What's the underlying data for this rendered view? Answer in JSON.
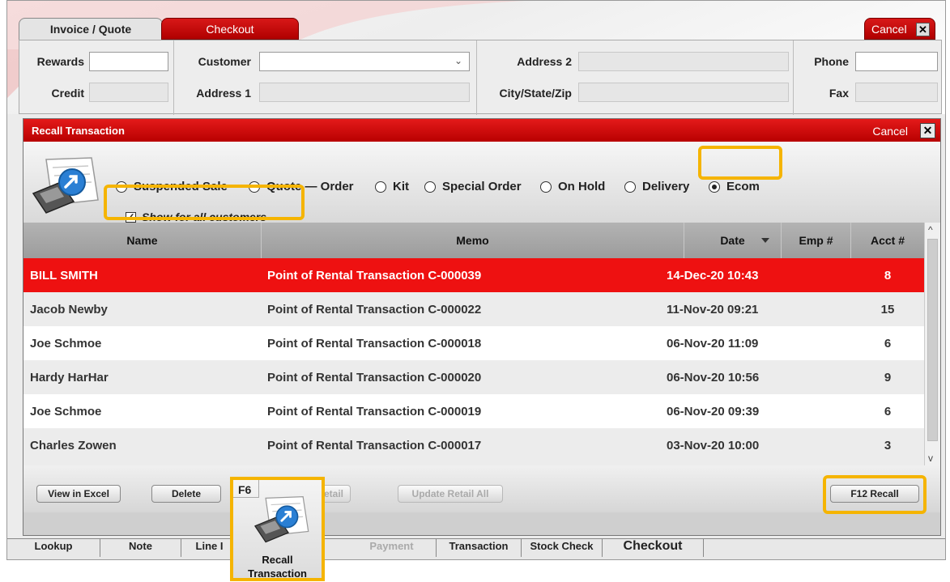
{
  "app": {
    "tabs": [
      {
        "label": "Invoice / Quote",
        "active": true
      },
      {
        "label": "Checkout",
        "active": false
      }
    ],
    "cancel_label": "Cancel",
    "close_icon": "close-icon",
    "fields": {
      "rewards_label": "Rewards",
      "credit_label": "Credit",
      "customer_label": "Customer",
      "address1_label": "Address 1",
      "address2_label": "Address 2",
      "city_label": "City/State/Zip",
      "phone_label": "Phone",
      "fax_label": "Fax",
      "rewards_value": "",
      "customer_value": "",
      "phone_value": ""
    },
    "bottom_bar": [
      "Lookup",
      "Note",
      "Line I",
      "Payment",
      "Transaction",
      "Stock Check",
      "Checkout"
    ]
  },
  "modal": {
    "title": "Recall Transaction",
    "cancel_label": "Cancel",
    "radios": [
      {
        "label": "Suspended Sale",
        "selected": false
      },
      {
        "label": "Quote — Order",
        "selected": false
      },
      {
        "label": "Kit",
        "selected": false
      },
      {
        "label": "Special Order",
        "selected": false
      },
      {
        "label": "On Hold",
        "selected": false
      },
      {
        "label": "Delivery",
        "selected": false
      },
      {
        "label": "Ecom",
        "selected": true
      }
    ],
    "show_all": {
      "label": "Show for all customers",
      "checked": true
    },
    "table": {
      "columns": [
        "Name",
        "Memo",
        "Date",
        "Emp #",
        "Acct #"
      ],
      "sort_column": "Date",
      "rows": [
        {
          "name": "BILL SMITH",
          "memo": "Point of Rental Transaction C-000039",
          "date": "14-Dec-20 10:43",
          "emp": "",
          "acct": "8",
          "selected": true
        },
        {
          "name": "Jacob Newby",
          "memo": "Point of Rental Transaction C-000022",
          "date": "11-Nov-20 09:21",
          "emp": "",
          "acct": "15"
        },
        {
          "name": "Joe Schmoe",
          "memo": "Point of Rental Transaction C-000018",
          "date": "06-Nov-20 11:09",
          "emp": "",
          "acct": "6"
        },
        {
          "name": "Hardy HarHar",
          "memo": "Point of Rental Transaction C-000020",
          "date": "06-Nov-20 10:56",
          "emp": "",
          "acct": "9"
        },
        {
          "name": "Joe Schmoe",
          "memo": "Point of Rental Transaction C-000019",
          "date": "06-Nov-20 09:39",
          "emp": "",
          "acct": "6"
        },
        {
          "name": "Charles Zowen",
          "memo": "Point of Rental Transaction C-000017",
          "date": "03-Nov-20 10:00",
          "emp": "",
          "acct": "3"
        }
      ]
    },
    "buttons": {
      "view_excel": "View in Excel",
      "delete": "Delete",
      "update_retail_partial": "etail",
      "update_retail_all": "Update Retail All",
      "recall": "F12 Recall"
    }
  },
  "f6_callout": {
    "key": "F6",
    "label": "Recall\nTransaction",
    "icon": "recall-transaction-icon"
  },
  "colors": {
    "brand_red": "#e41a1a",
    "selected_row": "#ee1111",
    "highlight": "#f5b400"
  }
}
